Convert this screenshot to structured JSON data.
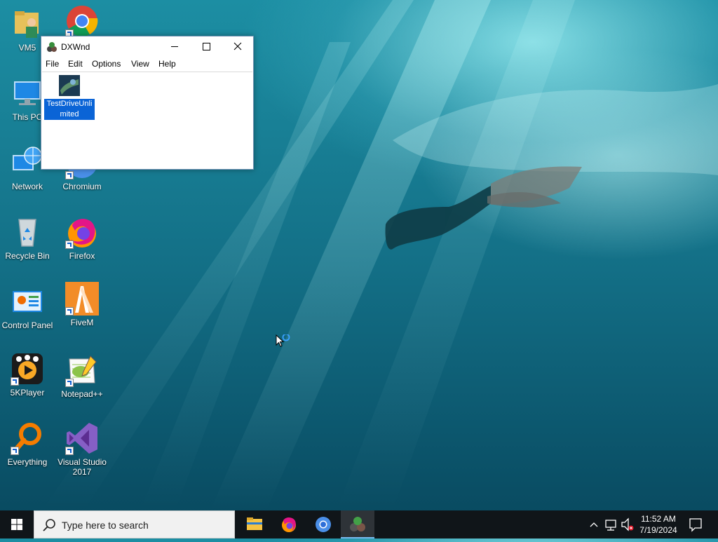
{
  "desktop": {
    "icons": [
      {
        "label": "VM5",
        "icon": "user-folder-icon"
      },
      {
        "label": "",
        "icon": "chrome-icon"
      },
      {
        "label": "This PC",
        "icon": "this-pc-icon"
      },
      {
        "label": "Network",
        "icon": "network-icon"
      },
      {
        "label": "Chromium",
        "icon": "chromium-icon"
      },
      {
        "label": "Recycle Bin",
        "icon": "recycle-bin-icon"
      },
      {
        "label": "Firefox",
        "icon": "firefox-icon"
      },
      {
        "label": "Control Panel",
        "icon": "control-panel-icon"
      },
      {
        "label": "FiveM",
        "icon": "fivem-icon"
      },
      {
        "label": "5KPlayer",
        "icon": "5kplayer-icon"
      },
      {
        "label": "Notepad++",
        "icon": "notepad-plus-plus-icon"
      },
      {
        "label": "Everything",
        "icon": "everything-search-icon"
      },
      {
        "label": "Visual Studio 2017",
        "icon": "visual-studio-icon"
      }
    ]
  },
  "window": {
    "title": "DXWnd",
    "menu": [
      "File",
      "Edit",
      "Options",
      "View",
      "Help"
    ],
    "item": {
      "label": "TestDriveUnlimited",
      "icon": "game-thumbnail-icon"
    }
  },
  "taskbar": {
    "search_placeholder": "Type here to search",
    "apps": [
      "file-explorer-icon",
      "firefox-icon",
      "chromium-icon",
      "dxwnd-icon"
    ],
    "clock_time": "11:52 AM",
    "clock_date": "7/19/2024"
  },
  "colors": {
    "selection": "#0a64d6",
    "taskbar": "#101519",
    "accent": "#76b9ed"
  }
}
